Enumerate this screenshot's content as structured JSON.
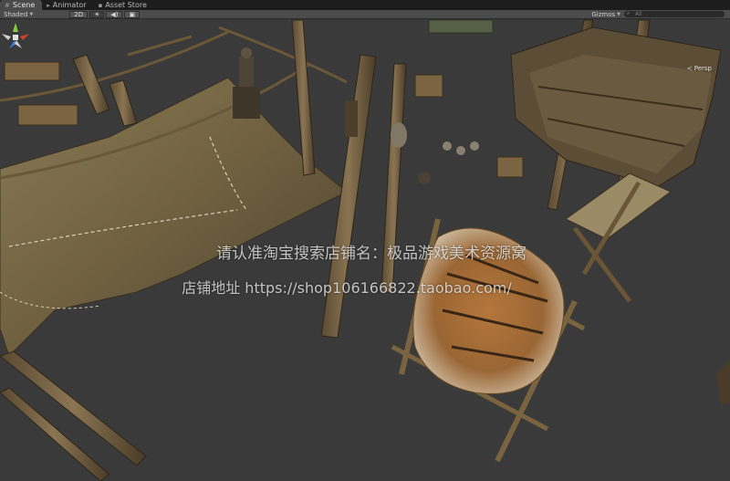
{
  "tabs": [
    {
      "label": "Scene",
      "icon": "scene-icon",
      "active": true
    },
    {
      "label": "Animator",
      "icon": "animator-icon",
      "active": false
    },
    {
      "label": "Asset Store",
      "icon": "asset-store-icon",
      "active": false
    }
  ],
  "toolbar": {
    "shading_mode": "Shaded",
    "toggle_2d": "2D",
    "gizmos_label": "Gizmos",
    "search_placeholder": "All"
  },
  "scene": {
    "projection_label": "Persp",
    "gizmo_axes": [
      "x",
      "y",
      "z"
    ],
    "watermark_line1": "请认准淘宝搜索店铺名：极品游戏美术资源窝",
    "watermark_line2": "店铺地址 https://shop106166822.taobao.com/"
  },
  "colors": {
    "background": "#3a3a3a",
    "tabbar": "#1d1d1d",
    "toolbar": "#4b4b4b",
    "axis_x": "#d9412f",
    "axis_y": "#7fcf3a",
    "axis_z": "#3a7ed9"
  }
}
